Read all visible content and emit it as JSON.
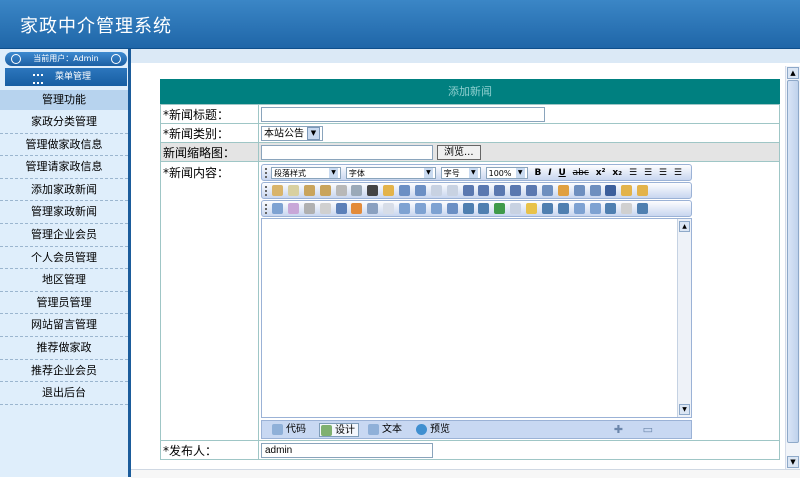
{
  "header": {
    "title": "家政中介管理系统"
  },
  "sidebar": {
    "current_user": "当前用户：Admin",
    "menu_header": "菜单管理",
    "section_title": "管理功能",
    "items": [
      {
        "label": "家政分类管理"
      },
      {
        "label": "管理做家政信息"
      },
      {
        "label": "管理请家政信息"
      },
      {
        "label": "添加家政新闻"
      },
      {
        "label": "管理家政新闻"
      },
      {
        "label": "管理企业会员"
      },
      {
        "label": "个人会员管理"
      },
      {
        "label": "地区管理"
      },
      {
        "label": "管理员管理"
      },
      {
        "label": "网站留言管理"
      },
      {
        "label": "推荐做家政"
      },
      {
        "label": "推荐企业会员"
      },
      {
        "label": "退出后台"
      }
    ]
  },
  "form": {
    "heading": "添加新闻",
    "title_label": "*新闻标题：",
    "title_value": "",
    "category_label": "*新闻类别：",
    "category_value": "本站公告",
    "thumb_label": "新闻缩略图：",
    "browse_label": "浏览...",
    "content_label": "*新闻内容：",
    "publisher_label": "*发布人：",
    "publisher_value": "admin"
  },
  "editor": {
    "paragraph_style": "段落样式",
    "font": "字体",
    "font_size": "字号",
    "zoom": "100%",
    "modes": [
      {
        "label": "代码"
      },
      {
        "label": "设计"
      },
      {
        "label": "文本"
      },
      {
        "label": "预览"
      }
    ],
    "active_mode": "设计"
  },
  "colors": {
    "header_blue": "#2a74b8",
    "form_head_teal": "#008080",
    "sidebar_bg": "#dfeefb"
  }
}
